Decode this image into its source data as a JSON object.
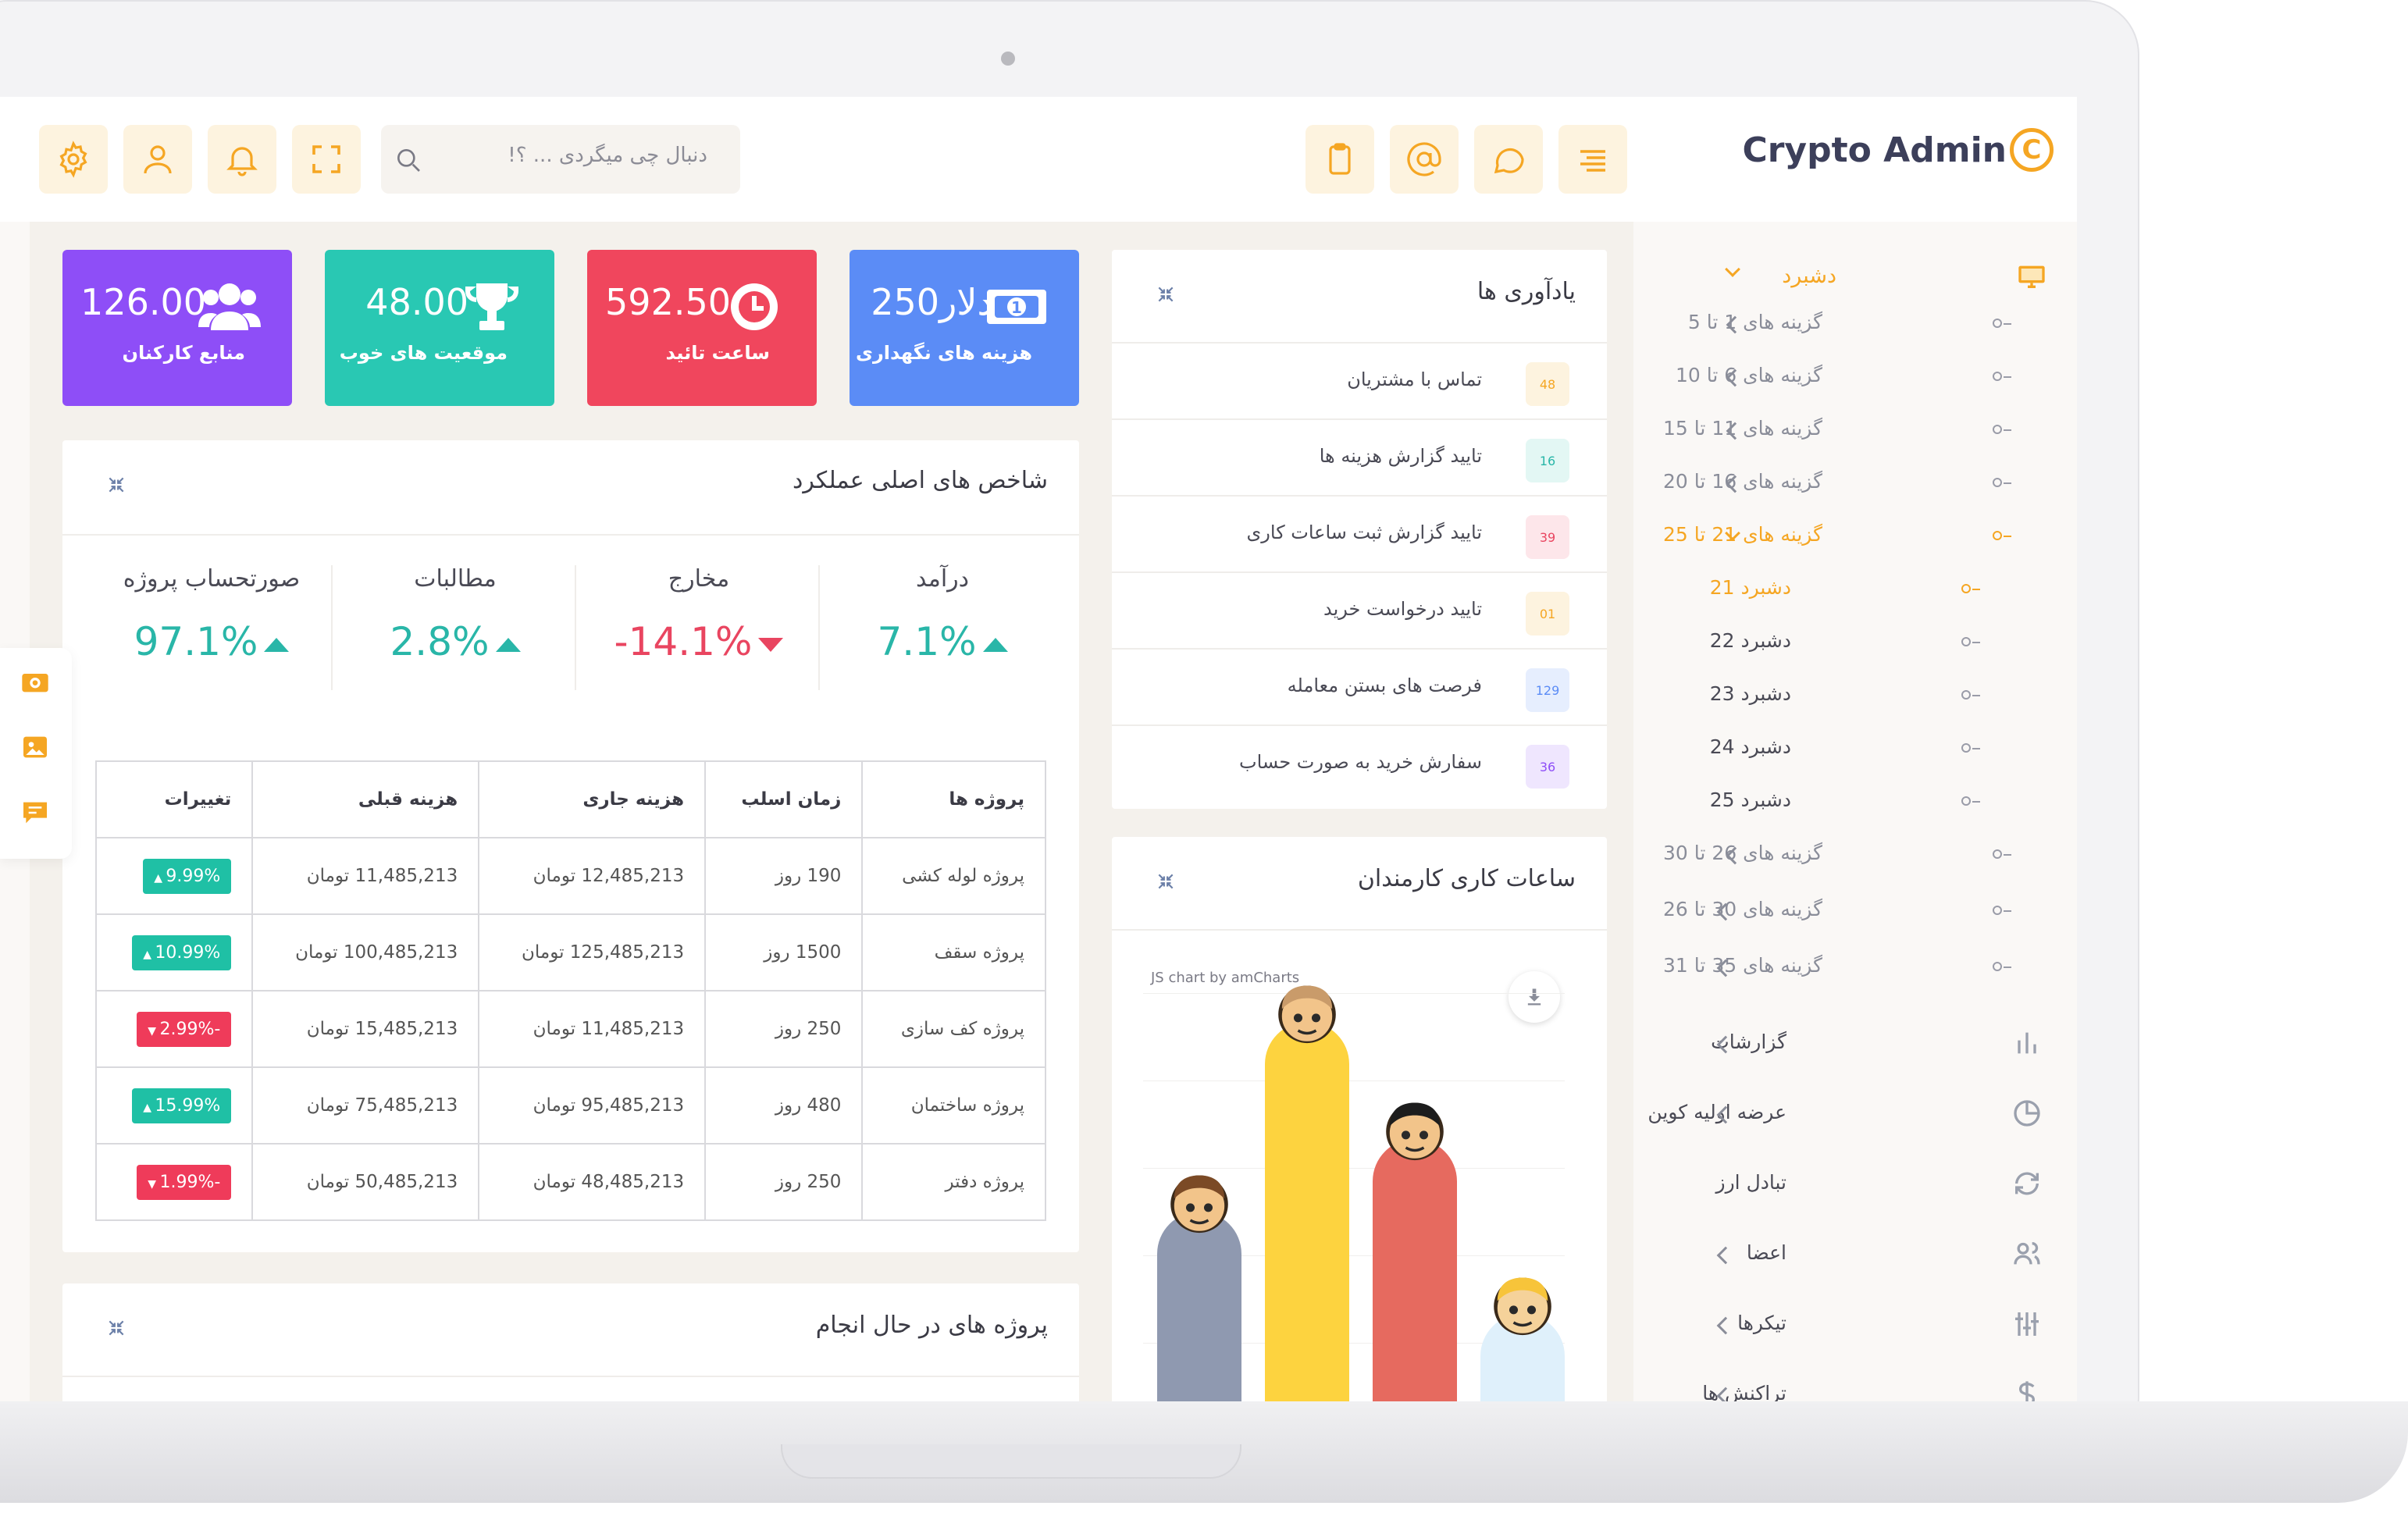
{
  "header": {
    "brand": "Crypto Admin",
    "brand_logo_char": "C",
    "search_placeholder": "دنبال چی میگردی ... ؟!",
    "left_icons": [
      "gear-icon",
      "user-icon",
      "bell-icon",
      "fullscreen-icon"
    ],
    "right_icons": [
      "clipboard-icon",
      "at-icon",
      "chat-icon",
      "menu-icon"
    ]
  },
  "stats": [
    {
      "value": "126.00",
      "label": "منابع کارکنان",
      "icon": "users-icon",
      "color": "#8e4ef7"
    },
    {
      "value": "48.00",
      "label": "موقعیت های خوب",
      "icon": "trophy-icon",
      "color": "#29c8b3"
    },
    {
      "value": "592.50",
      "label": "ساعت تائید",
      "icon": "clock-icon",
      "color": "#f0465d"
    },
    {
      "value": "250دلار",
      "label": "هزینه های نگهداری",
      "icon": "money-icon",
      "color": "#5b8cf6"
    }
  ],
  "kpi": {
    "title": "شاخص های اصلی عملکرد",
    "items": [
      {
        "label": "درآمد",
        "value": "7.1%",
        "trend": "up"
      },
      {
        "label": "مخارج",
        "value": "-14.1%",
        "trend": "down"
      },
      {
        "label": "مطالبات",
        "value": "2.8%",
        "trend": "up"
      },
      {
        "label": "صورتحساب پروژه",
        "value": "97.1%",
        "trend": "up"
      }
    ],
    "table": {
      "headers": [
        "پروژه ها",
        "زمان اسلب",
        "هزینه جاری",
        "هزینه قبلی",
        "تغییرات"
      ],
      "rows": [
        {
          "project": "پروژه لوله کشی",
          "time": "190 روز",
          "current": "12,485,213 تومان",
          "previous": "11,485,213 تومان",
          "change": "9.99%",
          "trend": "up"
        },
        {
          "project": "پروژه سقف",
          "time": "1500 روز",
          "current": "125,485,213 تومان",
          "previous": "100,485,213 تومان",
          "change": "10.99%",
          "trend": "up"
        },
        {
          "project": "پروژه کف سازی",
          "time": "250 روز",
          "current": "11,485,213 تومان",
          "previous": "15,485,213 تومان",
          "change": "-2.99%",
          "trend": "down"
        },
        {
          "project": "پروژه ساختمان",
          "time": "480 روز",
          "current": "95,485,213 تومان",
          "previous": "75,485,213 تومان",
          "change": "15.99%",
          "trend": "up"
        },
        {
          "project": "پروژه دفتر",
          "time": "250 روز",
          "current": "48,485,213 تومان",
          "previous": "50,485,213 تومان",
          "change": "-1.99%",
          "trend": "down"
        }
      ]
    }
  },
  "projects_card": {
    "title": "پروژه های در حال انجام"
  },
  "reminders": {
    "title": "یادآوری ها",
    "items": [
      {
        "text": "تماس با مشتریان",
        "num": "48",
        "color": "#f5a623",
        "bg": "#fdf3df"
      },
      {
        "text": "تایید گزارش هزینه ها",
        "num": "16",
        "color": "#29b6a8",
        "bg": "#e3f7f4"
      },
      {
        "text": "تایید گزارش ثبت ساعات کاری",
        "num": "39",
        "color": "#e94560",
        "bg": "#fde6ea"
      },
      {
        "text": "تایید درخواست خرید",
        "num": "01",
        "color": "#f5a623",
        "bg": "#fdf3df"
      },
      {
        "text": "فرصت های بستن معامله",
        "num": "129",
        "color": "#5b8cf6",
        "bg": "#e6eefe"
      },
      {
        "text": "سفارش خرید به صورت حساب",
        "num": "36",
        "color": "#8e4ef7",
        "bg": "#efe6fe"
      }
    ]
  },
  "work_hours": {
    "title": "ساعات کاری کارمندان",
    "credit": "JS chart by amCharts"
  },
  "chart_data": {
    "type": "bar",
    "categories": [
      "",
      "",
      "",
      ""
    ],
    "values": [
      30,
      56,
      40,
      16
    ],
    "colors": [
      "#8f99b0",
      "#fdd33f",
      "#e66a5f",
      "#dff0fb"
    ]
  },
  "sidebar": {
    "dashboard": "دشبرد",
    "groups": [
      {
        "label": "گزینه های 1 تا 5",
        "active": false
      },
      {
        "label": "گزینه های 6 تا 10",
        "active": false
      },
      {
        "label": "گزینه های 11 تا 15",
        "active": false
      },
      {
        "label": "گزینه های 16 تا 20",
        "active": false
      },
      {
        "label": "گزینه های 21 تا 25",
        "active": true
      }
    ],
    "sub_items": [
      {
        "label": "دشبرد 21",
        "active": true
      },
      {
        "label": "دشبرد 22",
        "active": false
      },
      {
        "label": "دشبرد 23",
        "active": false
      },
      {
        "label": "دشبرد 24",
        "active": false
      },
      {
        "label": "دشبرد 25",
        "active": false
      }
    ],
    "groups_after": [
      {
        "label": "گزینه های 26 تا 30"
      },
      {
        "label": "گزینه های 30 تا 26"
      },
      {
        "label": "گزینه های 35 تا 31"
      }
    ],
    "menu": [
      {
        "label": "گزارشات",
        "icon": "bar-chart-icon"
      },
      {
        "label": "عرضه اولیه کوین",
        "icon": "pie-chart-icon"
      },
      {
        "label": "تبادل ارز",
        "icon": "refresh-icon"
      },
      {
        "label": "اعضا",
        "icon": "users-icon"
      },
      {
        "label": "تیکرها",
        "icon": "sliders-icon"
      },
      {
        "label": "تراکنش ها",
        "icon": "dollar-icon"
      }
    ]
  }
}
